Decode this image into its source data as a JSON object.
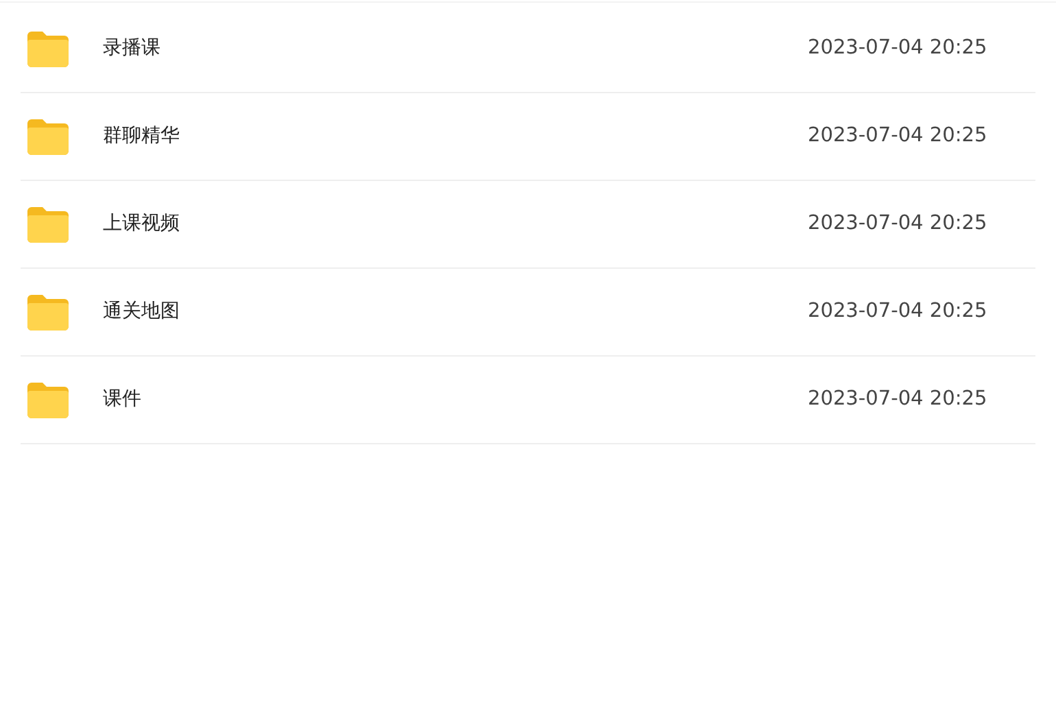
{
  "files": [
    {
      "name": "录播课",
      "modified": "2023-07-04 20:25"
    },
    {
      "name": "群聊精华",
      "modified": "2023-07-04 20:25"
    },
    {
      "name": "上课视频",
      "modified": "2023-07-04 20:25"
    },
    {
      "name": "通关地图",
      "modified": "2023-07-04 20:25"
    },
    {
      "name": "课件",
      "modified": "2023-07-04 20:25"
    }
  ]
}
